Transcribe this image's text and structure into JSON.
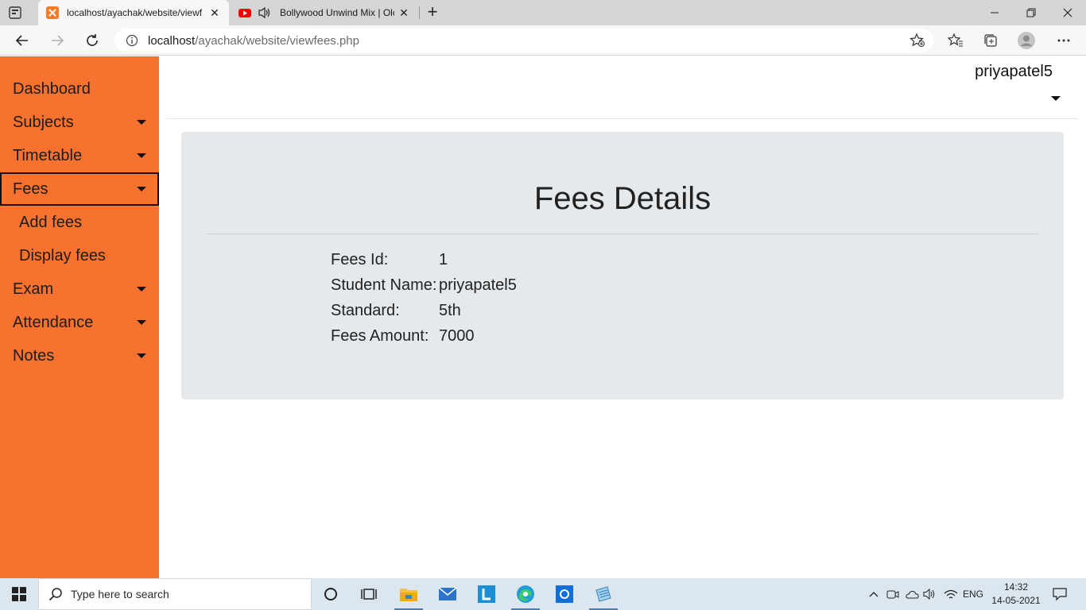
{
  "browser": {
    "tabs": [
      {
        "title": "localhost/ayachak/website/viewf",
        "active": true
      },
      {
        "title": "Bollywood Unwind Mix | Olc",
        "active": false
      }
    ],
    "url_host": "localhost",
    "url_path": "/ayachak/website/viewfees.php"
  },
  "sidebar": {
    "items": [
      {
        "label": "Dashboard",
        "has_caret": false
      },
      {
        "label": "Subjects",
        "has_caret": true
      },
      {
        "label": "Timetable",
        "has_caret": true
      },
      {
        "label": "Fees",
        "has_caret": true,
        "selected": true
      },
      {
        "label": "Add fees",
        "sub": true
      },
      {
        "label": "Display fees",
        "sub": true
      },
      {
        "label": "Exam",
        "has_caret": true
      },
      {
        "label": "Attendance",
        "has_caret": true
      },
      {
        "label": "Notes",
        "has_caret": true
      }
    ]
  },
  "header": {
    "username": "priyapatel5"
  },
  "content": {
    "title": "Fees Details",
    "fields": [
      {
        "label": "Fees Id:",
        "value": "1"
      },
      {
        "label": "Student Name:",
        "value": "priyapatel5"
      },
      {
        "label": "Standard:",
        "value": "5th"
      },
      {
        "label": "Fees Amount:",
        "value": "7000"
      }
    ]
  },
  "taskbar": {
    "search_placeholder": "Type here to search",
    "language": "ENG",
    "time": "14:32",
    "date": "14-05-2021"
  },
  "colors": {
    "sidebar": "#f8722f",
    "card": "#e6e9ec",
    "taskbar": "#dbe6ef"
  }
}
